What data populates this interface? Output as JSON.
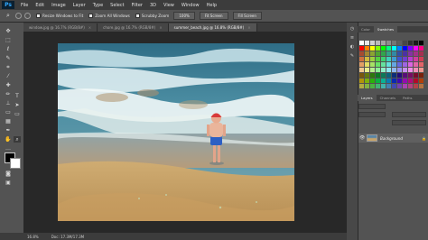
{
  "app": {
    "logo": "Ps"
  },
  "menu": [
    "File",
    "Edit",
    "Image",
    "Layer",
    "Type",
    "Select",
    "Filter",
    "3D",
    "View",
    "Window",
    "Help"
  ],
  "options_bar": {
    "tool_icon": "zoom-tool-icon",
    "resize_label": "Resize Windows to Fit",
    "zoom_all_label": "Zoom All Windows",
    "scrubby_label": "Scrubby Zoom",
    "btn_100": "100%",
    "btn_fit": "Fit Screen",
    "btn_fill": "Fill Screen"
  },
  "tabs": [
    {
      "label": "window.jpg @ 16.7% (RGB/8#)",
      "active": false
    },
    {
      "label": "chore.jpg @ 16.7% (RGB/8#)",
      "active": false
    },
    {
      "label": "summer_beach.jpg @ 16.8% (RGB/8#)",
      "active": true
    }
  ],
  "tab_close": "×",
  "panels": {
    "color_tab": "Color",
    "swatches_tab": "Swatches",
    "layers_tab": "Layers",
    "channels_tab": "Channels",
    "paths_tab": "Paths"
  },
  "layer": {
    "name": "Background",
    "eye": "👁",
    "lock": "🔒"
  },
  "status": {
    "zoom": "16.8%",
    "doc": "Doc: 17.3M/17.3M"
  },
  "colors": {
    "foreground": "#000000",
    "background": "#ffffff",
    "accent": "#31a8ff"
  }
}
